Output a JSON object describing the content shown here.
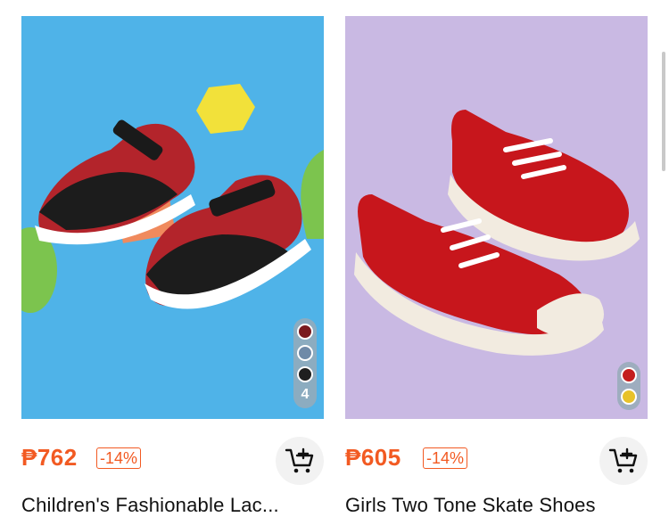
{
  "products": [
    {
      "price": "₱762",
      "discount": "-14%",
      "title": "Children's Fashionable Lac...",
      "image_icon": "black-red-sneakers-image",
      "swatches": [
        "#7a1a1e",
        "#6f8aa8",
        "#1f1f1f"
      ],
      "swatch_more": "4"
    },
    {
      "price": "₱605",
      "discount": "-14%",
      "title": "Girls Two Tone Skate Shoes",
      "image_icon": "red-canvas-shoes-image",
      "swatches": [
        "#c41e1e",
        "#e8c22a"
      ]
    }
  ],
  "cart_icon": "add-to-cart-icon",
  "colors": {
    "accent": "#f25a22"
  }
}
